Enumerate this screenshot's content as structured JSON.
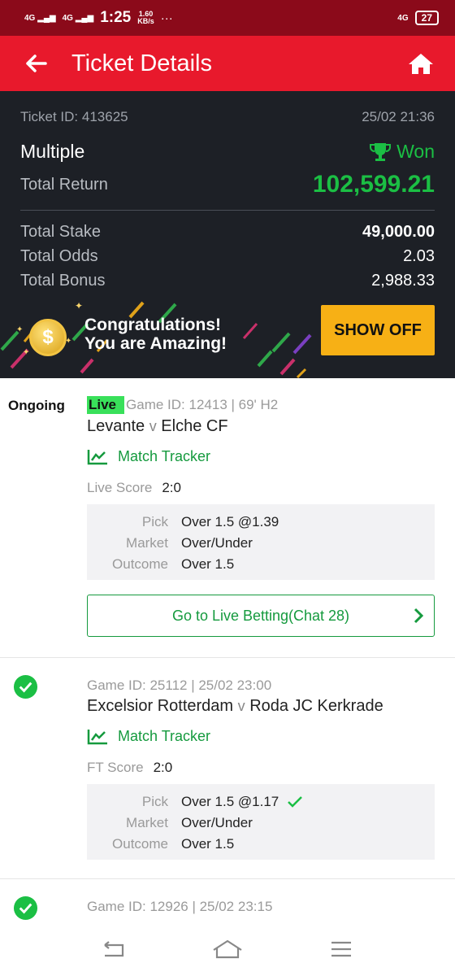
{
  "status_bar": {
    "sig1": "4G",
    "sig2": "4G",
    "time": "1:25",
    "speed_value": "1.60",
    "speed_unit": "KB/s",
    "dots": "···",
    "net_right": "4G",
    "battery": "27"
  },
  "app_bar": {
    "title": "Ticket Details"
  },
  "summary": {
    "ticket_id": "Ticket ID: 413625",
    "datetime": "25/02 21:36",
    "type": "Multiple",
    "status": "Won",
    "total_return_label": "Total Return",
    "total_return": "102,599.21",
    "stake_label": "Total Stake",
    "stake": "49,000.00",
    "odds_label": "Total Odds",
    "odds": "2.03",
    "bonus_label": "Total Bonus",
    "bonus": "2,988.33",
    "congrats_1": "Congratulations!",
    "congrats_2": "You are Amazing!",
    "show_off": "SHOW OFF"
  },
  "bets": [
    {
      "status": "Ongoing",
      "live_badge": "Live",
      "meta": "Game ID: 12413 | 69' H2",
      "home": "Levante",
      "v": "v",
      "away": "Elche CF",
      "tracker": "Match Tracker",
      "score_label": "Live Score",
      "score": "2:0",
      "pick_label": "Pick",
      "pick": "Over 1.5 @1.39",
      "market_label": "Market",
      "market": "Over/Under",
      "outcome_label": "Outcome",
      "outcome": "Over 1.5",
      "live_betting": "Go to Live Betting(Chat 28)"
    },
    {
      "meta": "Game ID: 25112 | 25/02 23:00",
      "home": "Excelsior Rotterdam",
      "v": "v",
      "away": "Roda JC Kerkrade",
      "tracker": "Match Tracker",
      "score_label": "FT Score",
      "score": "2:0",
      "pick_label": "Pick",
      "pick": "Over 1.5 @1.17",
      "market_label": "Market",
      "market": "Over/Under",
      "outcome_label": "Outcome",
      "outcome": "Over 1.5"
    },
    {
      "meta": "Game ID: 12926 | 25/02 23:15"
    }
  ],
  "colors": {
    "brand_red": "#e8192c",
    "dark_panel": "#1d2026",
    "win_green": "#1bbf44",
    "accent_green": "#159a3e",
    "showoff_yellow": "#f7b015"
  }
}
